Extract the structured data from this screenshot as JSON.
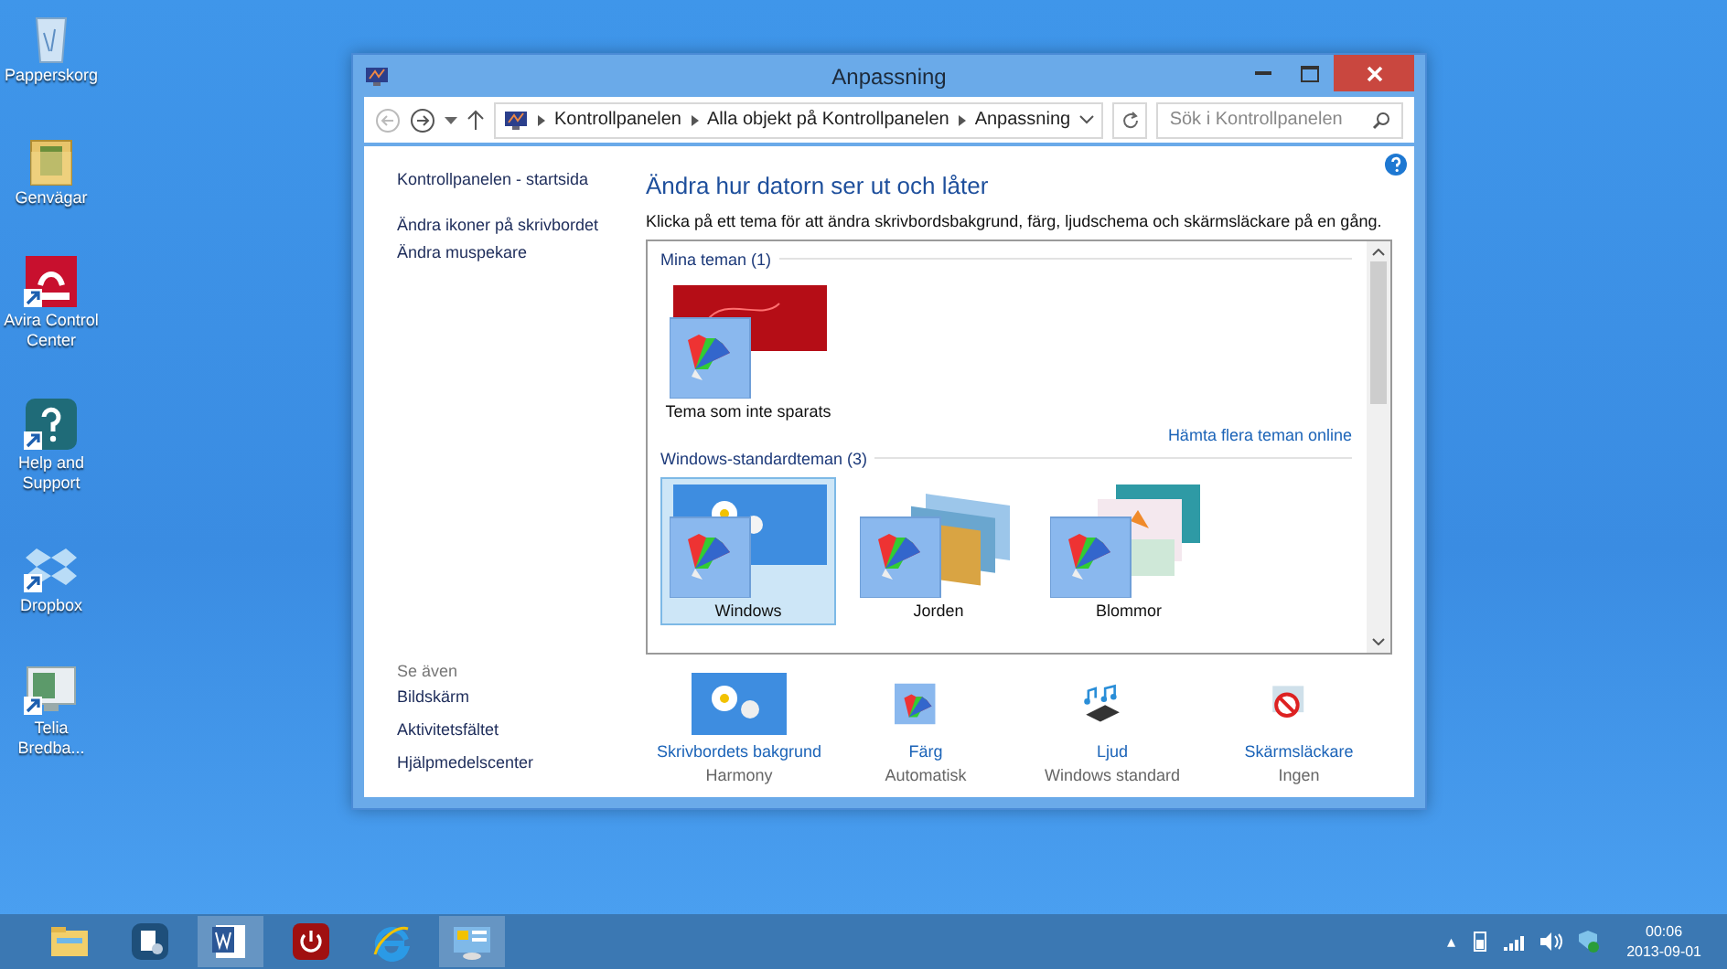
{
  "desktop_icons": [
    {
      "label": "Papperskorg",
      "kind": "recycle",
      "shortcut": false
    },
    {
      "label": "Genvägar",
      "kind": "folder",
      "shortcut": false
    },
    {
      "label": "Avira Control Center",
      "kind": "avira",
      "shortcut": true
    },
    {
      "label": "Help and Support",
      "kind": "help",
      "shortcut": true
    },
    {
      "label": "Dropbox",
      "kind": "dropbox",
      "shortcut": true
    },
    {
      "label": "Telia Bredba...",
      "kind": "monitor",
      "shortcut": true
    }
  ],
  "window": {
    "title": "Anpassning",
    "address": {
      "crumbs": [
        "Kontrollpanelen",
        "Alla objekt på Kontrollpanelen",
        "Anpassning"
      ],
      "search_placeholder": "Sök i Kontrollpanelen"
    },
    "sidebar": {
      "home_link": "Kontrollpanelen - startsida",
      "links": [
        "Ändra ikoner på skrivbordet",
        "Ändra muspekare"
      ],
      "see_also": {
        "heading": "Se även",
        "links": [
          "Bildskärm",
          "Aktivitetsfältet",
          "Hjälpmedelscenter"
        ]
      }
    },
    "main": {
      "heading": "Ändra hur datorn ser ut och låter",
      "description": "Klicka på ett tema för att ändra skrivbordsbakgrund, färg, ljudschema och skärmsläckare på en gång.",
      "theme_groups": [
        {
          "title": "Mina teman (1)",
          "themes": [
            {
              "label": "Tema som inte sparats",
              "kind": "red",
              "selected": false
            }
          ],
          "link": "Hämta flera teman online"
        },
        {
          "title": "Windows-standardteman (3)",
          "themes": [
            {
              "label": "Windows",
              "kind": "windows",
              "selected": true
            },
            {
              "label": "Jorden",
              "kind": "earth",
              "selected": false
            },
            {
              "label": "Blommor",
              "kind": "flowers",
              "selected": false
            }
          ]
        }
      ]
    },
    "settings": [
      {
        "label": "Skrivbordets bakgrund",
        "value": "Harmony",
        "kind": "background"
      },
      {
        "label": "Färg",
        "value": "Automatisk",
        "kind": "color"
      },
      {
        "label": "Ljud",
        "value": "Windows standard",
        "kind": "sound"
      },
      {
        "label": "Skärmsläckare",
        "value": "Ingen",
        "kind": "screensaver"
      }
    ]
  },
  "taskbar": {
    "apps": [
      {
        "kind": "explorer",
        "active": false
      },
      {
        "kind": "settings-doc",
        "active": false
      },
      {
        "kind": "word",
        "active": true
      },
      {
        "kind": "power",
        "active": false
      },
      {
        "kind": "ie",
        "active": false
      },
      {
        "kind": "control-panel",
        "active": true
      }
    ],
    "tray": {
      "caret": "▴",
      "time": "00:06",
      "date": "2013-09-01"
    }
  }
}
